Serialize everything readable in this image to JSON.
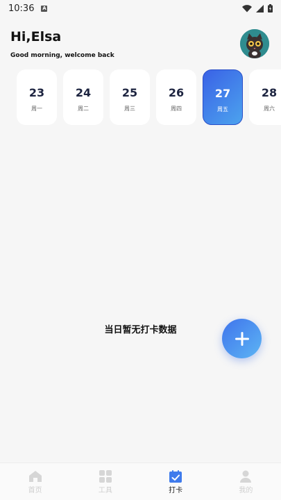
{
  "status": {
    "time": "10:36",
    "a_badge": "A"
  },
  "header": {
    "greeting": "Hi,Elsa",
    "subtitle": "Good morning, welcome back"
  },
  "week": [
    {
      "date": "23",
      "weekday": "周一",
      "active": false
    },
    {
      "date": "24",
      "weekday": "周二",
      "active": false
    },
    {
      "date": "25",
      "weekday": "周三",
      "active": false
    },
    {
      "date": "26",
      "weekday": "周四",
      "active": false
    },
    {
      "date": "27",
      "weekday": "周五",
      "active": true
    },
    {
      "date": "28",
      "weekday": "周六",
      "active": false
    }
  ],
  "empty_text": "当日暂无打卡数据",
  "fab_icon": "plus-icon",
  "tabs": [
    {
      "label": "首页",
      "icon": "home-icon",
      "active": false
    },
    {
      "label": "工具",
      "icon": "grid-icon",
      "active": false
    },
    {
      "label": "打卡",
      "icon": "calendar-check-icon",
      "active": true
    },
    {
      "label": "我的",
      "icon": "person-icon",
      "active": false
    }
  ],
  "colors": {
    "accent_start": "#3a62e6",
    "accent_end": "#4ca3ee",
    "tab_inactive": "#cfcfcf"
  }
}
